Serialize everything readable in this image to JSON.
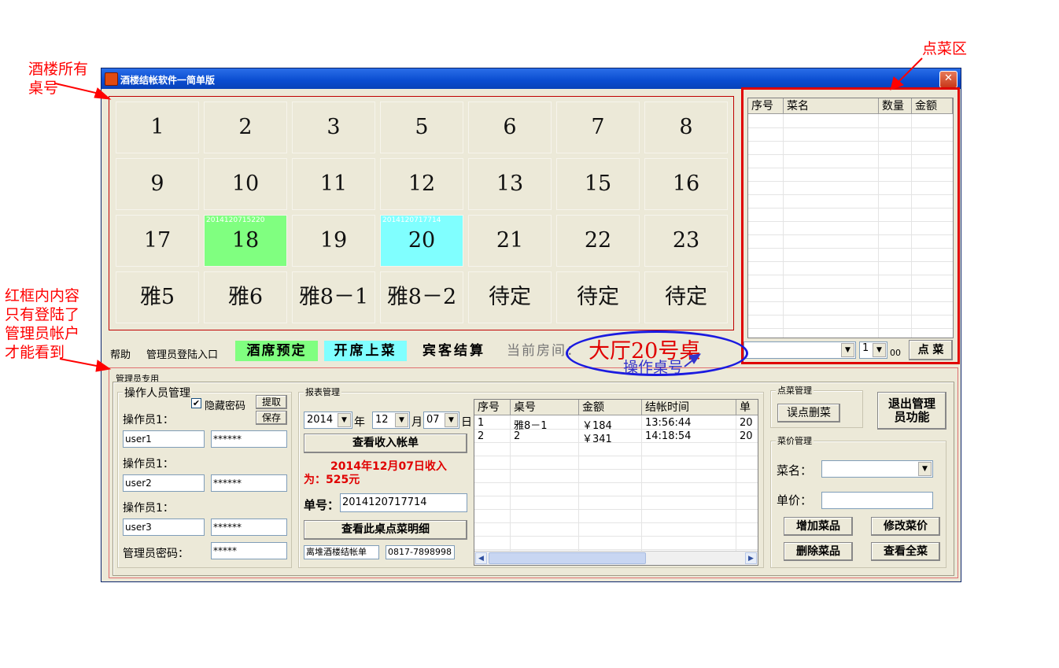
{
  "annotations": {
    "all_tables": [
      "酒楼所有",
      "桌号"
    ],
    "order_area": "点菜区",
    "red_box_note": [
      "红框内内容",
      "只有登陆了",
      "管理员帐户",
      "才能看到"
    ],
    "current_table_callout": "大厅20号桌",
    "operate_table_callout": "操作桌号"
  },
  "window": {
    "title": "酒楼结帐软件一简单版",
    "close": "✕"
  },
  "tables": [
    {
      "label": "1"
    },
    {
      "label": "2"
    },
    {
      "label": "3"
    },
    {
      "label": "5"
    },
    {
      "label": "6"
    },
    {
      "label": "7"
    },
    {
      "label": "8"
    },
    {
      "label": "9"
    },
    {
      "label": "10"
    },
    {
      "label": "11"
    },
    {
      "label": "12"
    },
    {
      "label": "13"
    },
    {
      "label": "15"
    },
    {
      "label": "16"
    },
    {
      "label": "17"
    },
    {
      "label": "18",
      "order_no": "2014120715220",
      "color": "#80ff80"
    },
    {
      "label": "19"
    },
    {
      "label": "20",
      "order_no": "2014120717714",
      "color": "#80ffff"
    },
    {
      "label": "21"
    },
    {
      "label": "22"
    },
    {
      "label": "23"
    },
    {
      "label": "雅5"
    },
    {
      "label": "雅6"
    },
    {
      "label": "雅8－1"
    },
    {
      "label": "雅8－2"
    },
    {
      "label": "待定"
    },
    {
      "label": "待定"
    },
    {
      "label": "待定"
    }
  ],
  "order_panel": {
    "columns": [
      "序号",
      "菜名",
      "数量",
      "金额"
    ],
    "dish_select": "",
    "qty_select": "1",
    "unit": "00",
    "order_button": "点 菜"
  },
  "action_bar": {
    "help": "帮助",
    "admin_login": "管理员登陆入口",
    "reserve": "酒席预定",
    "reserve_color": "#80ff80",
    "serve": "开席上菜",
    "serve_color": "#80ffff",
    "checkout": "宾客结算",
    "current_room_label": "当前房间："
  },
  "admin": {
    "group_title": "管理员专用",
    "operators": {
      "title": "操作人员管理",
      "hide_password_label": "隐藏密码",
      "hide_password_checked": true,
      "fetch_button": "提取",
      "save_button": "保存",
      "rows": [
        {
          "label": "操作员1：",
          "user": "user1",
          "password": "******"
        },
        {
          "label": "操作员1：",
          "user": "user2",
          "password": "******"
        },
        {
          "label": "操作员1：",
          "user": "user3",
          "password": "******"
        }
      ],
      "admin_password_label": "管理员密码：",
      "admin_password": "*****"
    },
    "report": {
      "title": "报表管理",
      "year": "2014",
      "year_suffix": "年",
      "month": "12",
      "month_suffix": "月",
      "day": "07",
      "day_suffix": "日",
      "view_income_button": "查看收入帐单",
      "income_text_line1": "2014年12月07日收入",
      "income_text_line2": "为：525元",
      "order_no_label": "单号：",
      "order_no": "2014120717714",
      "view_detail_button": "查看此桌点菜明细",
      "footer_name": "离堆酒楼结帐单",
      "footer_phone": "0817-7898998",
      "columns": [
        "序号",
        "桌号",
        "金额",
        "结帐时间",
        "单"
      ],
      "rows": [
        [
          "1",
          "雅8－1",
          "￥184",
          "13:56:44",
          "20"
        ],
        [
          "2",
          "2",
          "￥341",
          "14:18:54",
          "20"
        ]
      ]
    },
    "menu_mgmt": {
      "title": "点菜管理",
      "delete_wrong_button": "误点删菜"
    },
    "exit_admin_button": [
      "退出管理",
      "员功能"
    ],
    "price_mgmt": {
      "title": "菜价管理",
      "dish_label": "菜名：",
      "dish_value": "",
      "price_label": "单价：",
      "price_value": "",
      "add_button": "增加菜品",
      "modify_button": "修改菜价",
      "delete_button": "删除菜品",
      "view_all_button": "查看全菜"
    }
  }
}
